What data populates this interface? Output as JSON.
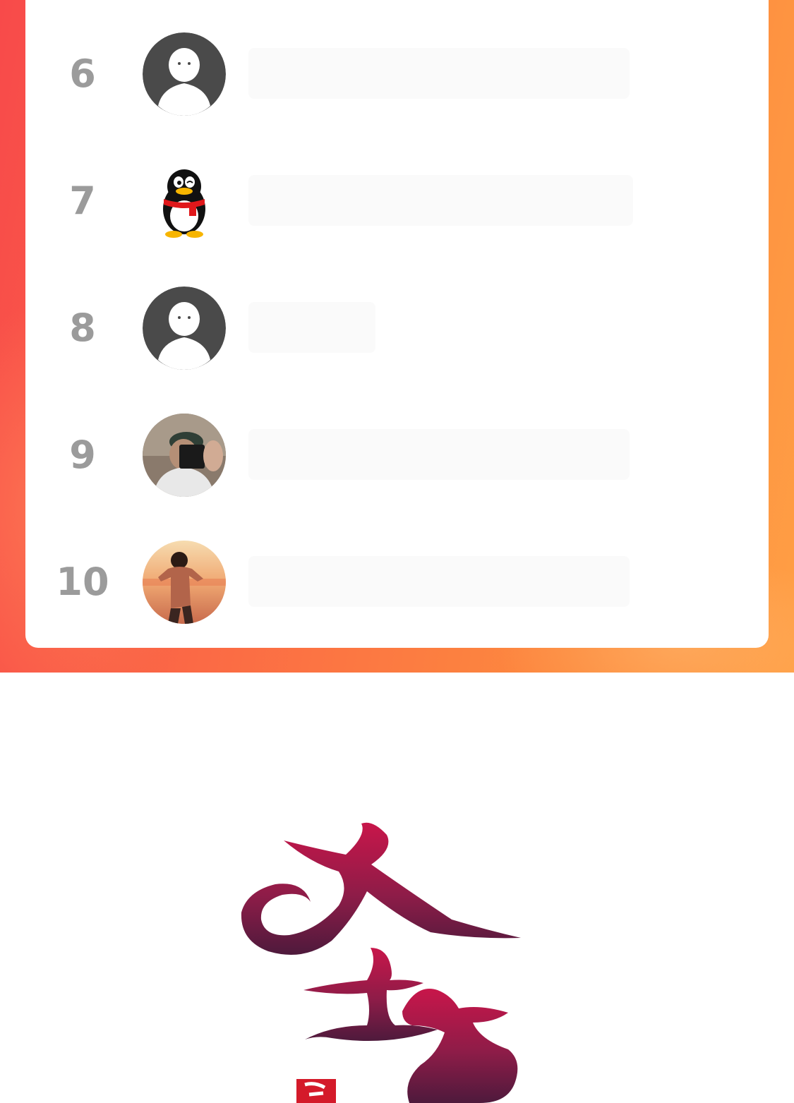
{
  "ranking": {
    "rows": [
      {
        "rank": "6",
        "avatar_icon": "default-person-icon"
      },
      {
        "rank": "7",
        "avatar_icon": "qq-penguin-icon"
      },
      {
        "rank": "8",
        "avatar_icon": "default-person-icon"
      },
      {
        "rank": "9",
        "avatar_icon": "photo-selfie-icon"
      },
      {
        "rank": "10",
        "avatar_icon": "photo-anime-icon"
      }
    ]
  },
  "logo": {
    "text": "圣墟",
    "colors": {
      "top": "#c4184a",
      "bottom": "#5a1a3c"
    }
  },
  "colors": {
    "frame_start": "#f84a4a",
    "frame_end": "#ff9f45",
    "rank_text": "#9b9b9b",
    "card": "#ffffff"
  }
}
